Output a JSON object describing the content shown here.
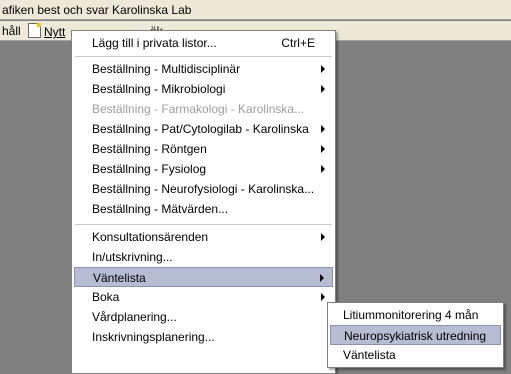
{
  "window": {
    "title": "afiken best och svar Karolinska Lab"
  },
  "toolbar": {
    "left_label": "håll",
    "new_label": "Nytt",
    "behind_label": "ök..."
  },
  "menu": {
    "items": [
      {
        "label": "Lägg till i privata listor...",
        "shortcut": "Ctrl+E"
      },
      {
        "label": "Beställning - Multidisciplinär",
        "submenu": true
      },
      {
        "label": "Beställning - Mikrobiologi",
        "submenu": true
      },
      {
        "label": "Beställning - Farmakologi - Karolinska...",
        "disabled": true
      },
      {
        "label": "Beställning - Pat/Cytologilab - Karolinska",
        "submenu": true
      },
      {
        "label": "Beställning - Röntgen",
        "submenu": true
      },
      {
        "label": "Beställning - Fysiolog",
        "submenu": true
      },
      {
        "label": "Beställning - Neurofysiologi - Karolinska..."
      },
      {
        "label": "Beställning - Mätvärden..."
      },
      {
        "label": "Konsultationsärenden",
        "submenu": true
      },
      {
        "label": "In/utskrivning..."
      },
      {
        "label": "Väntelista",
        "submenu": true,
        "selected": true
      },
      {
        "label": "Boka",
        "submenu": true
      },
      {
        "label": "Vårdplanering..."
      },
      {
        "label": "Inskrivningsplanering..."
      }
    ]
  },
  "submenu": {
    "items": [
      {
        "label": "Litiummonitorering 4 mån"
      },
      {
        "label": "Neuropsykiatrisk utredning",
        "selected": true
      },
      {
        "label": "Väntelista"
      }
    ]
  },
  "colors": {
    "menu_highlight": "#b6bdd2",
    "workspace": "#808080",
    "chrome": "#ece9d8"
  }
}
